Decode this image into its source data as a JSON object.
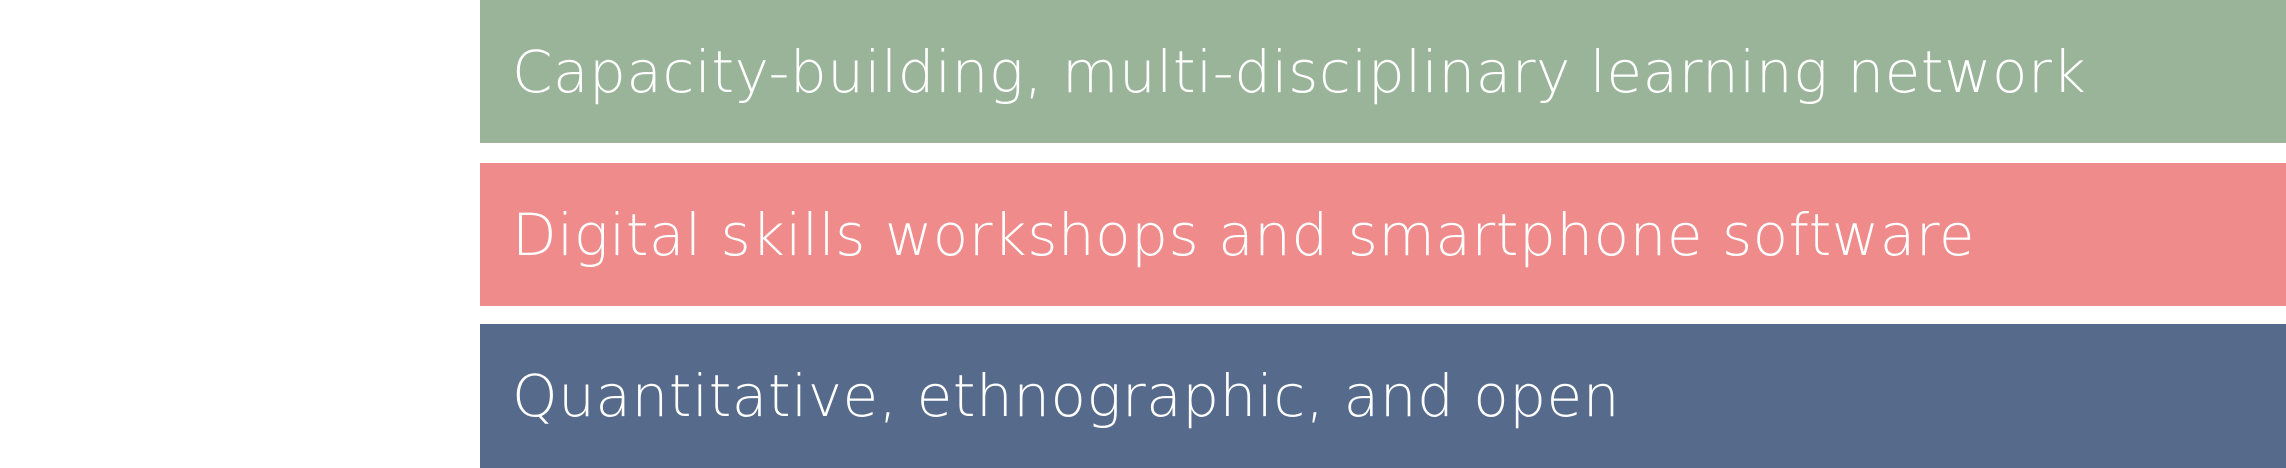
{
  "bands": [
    {
      "label": "Capacity-building, multi-disciplinary learning network",
      "color": "#9ab49a"
    },
    {
      "label": "Digital skills workshops and smartphone software",
      "color": "#ef8b8b"
    },
    {
      "label": "Quantitative, ethnographic, and open",
      "color": "#566b8c"
    }
  ]
}
